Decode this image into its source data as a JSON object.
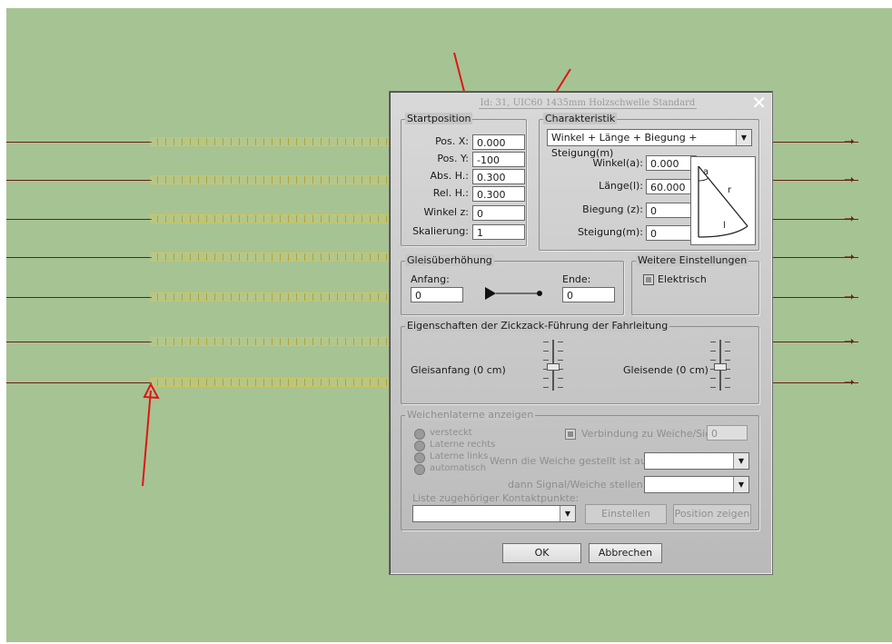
{
  "dialog": {
    "title": "Id: 31, UIC60 1435mm Holzschwelle Standard",
    "close_glyph": "✕"
  },
  "startposition": {
    "legend": "Startposition",
    "fields": [
      {
        "label": "Pos. X:",
        "value": "0.000"
      },
      {
        "label": "Pos. Y:",
        "value": "-100"
      },
      {
        "label": "Abs. H.:",
        "value": "0.300"
      },
      {
        "label": "Rel. H.:",
        "value": "0.300"
      },
      {
        "label": "Winkel z:",
        "value": "0"
      },
      {
        "label": "Skalierung:",
        "value": "1"
      }
    ]
  },
  "charakteristik": {
    "legend": "Charakteristik",
    "mode": "Winkel + Länge + Biegung + Steigung(m)",
    "fields": [
      {
        "label": "Winkel(a):",
        "value": "0.000"
      },
      {
        "label": "Länge(l):",
        "value": "60.000"
      },
      {
        "label": "Biegung (z):",
        "value": "0"
      },
      {
        "label": "Steigung(m):",
        "value": "0"
      }
    ],
    "diagram_labels": {
      "a": "a",
      "r": "r",
      "l": "l"
    }
  },
  "gleisueberhoehung": {
    "legend": "Gleisüberhöhung",
    "start_label": "Anfang:",
    "start_value": "0",
    "end_label": "Ende:",
    "end_value": "0"
  },
  "weitere": {
    "legend": "Weitere Einstellungen",
    "elektrisch_label": "Elektrisch"
  },
  "zickzack": {
    "legend": "Eigenschaften der Zickzack-Führung der Fahrleitung",
    "left_label": "Gleisanfang (0 cm)",
    "right_label": "Gleisende (0 cm)",
    "left_level": 0.5,
    "right_level": 0.5
  },
  "weichenlaterne": {
    "legend": "Weichenlaterne anzeigen",
    "radios": [
      "versteckt",
      "Laterne rechts",
      "Laterne links",
      "automatisch"
    ],
    "verbindung_label": "Verbindung zu Weiche/Signal",
    "verbindung_value": "0",
    "wenn_label": "Wenn die Weiche gestellt ist auf:",
    "dann_label": "dann Signal/Weiche stellen auf:",
    "liste_label": "Liste zugehöriger Kontaktpunkte:",
    "einstellen": "Einstellen",
    "position_zeigen": "Position zeigen"
  },
  "footer": {
    "ok": "OK",
    "cancel": "Abbrechen"
  },
  "colors": {
    "background": "#a6c393",
    "rail": "#6b1f12",
    "sleeper": "#d2c45a",
    "annotation": "#e01515"
  }
}
